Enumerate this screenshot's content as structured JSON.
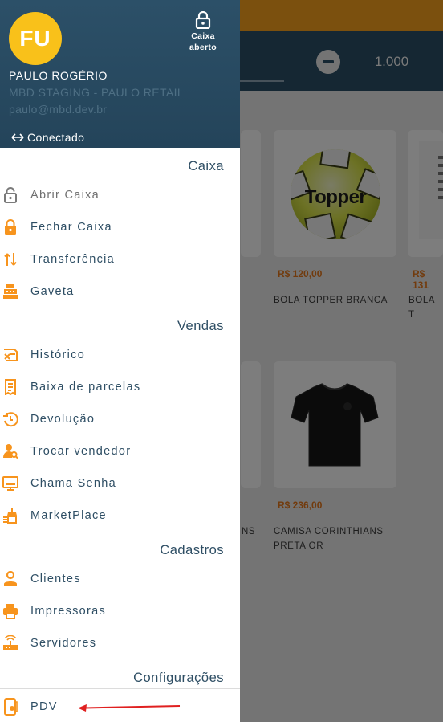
{
  "background": {
    "quantity": "1.000",
    "products": [
      {
        "price": "R$ 120,00",
        "name": "BOLA TOPPER BRANCA"
      },
      {
        "price": "R$ 131",
        "name": "BOLA T"
      },
      {
        "price": "R$ 236,00",
        "name_line1": "CAMISA CORINTHIANS",
        "name_line2": "PRETA OR"
      },
      {
        "fragment": "NS"
      }
    ],
    "ball_logo_text": "Topper"
  },
  "drawer": {
    "avatar_initials": "FU",
    "caixa_status": {
      "line1": "Caixa",
      "line2": "aberto",
      "icon": "lock-open-icon"
    },
    "user": {
      "name": "PAULO ROGÉRIO",
      "store": "MBD STAGING - PAULO RETAIL",
      "email": "paulo@mbd.dev.br"
    },
    "connection": {
      "label": "Conectado",
      "icon": "arrows-horizontal-icon"
    },
    "sections": [
      {
        "title": "Caixa",
        "items": [
          {
            "label": "Abrir Caixa",
            "icon": "lock-open-icon",
            "disabled": true
          },
          {
            "label": "Fechar Caixa",
            "icon": "lock-icon"
          },
          {
            "label": "Transferência",
            "icon": "swap-vertical-icon"
          },
          {
            "label": "Gaveta",
            "icon": "cash-register-icon"
          }
        ]
      },
      {
        "title": "Vendas",
        "items": [
          {
            "label": "Histórico",
            "icon": "history-icon"
          },
          {
            "label": "Baixa de parcelas",
            "icon": "receipt-icon"
          },
          {
            "label": "Devolução",
            "icon": "return-icon"
          },
          {
            "label": "Trocar vendedor",
            "icon": "user-search-icon"
          },
          {
            "label": "Chama Senha",
            "icon": "monitor-icon"
          },
          {
            "label": "MarketPlace",
            "icon": "marketplace-icon"
          }
        ]
      },
      {
        "title": "Cadastros",
        "items": [
          {
            "label": "Clientes",
            "icon": "person-icon"
          },
          {
            "label": "Impressoras",
            "icon": "printer-icon"
          },
          {
            "label": "Servidores",
            "icon": "router-icon"
          }
        ]
      },
      {
        "title": "Configurações",
        "items": [
          {
            "label": "PDV",
            "icon": "pos-device-icon"
          }
        ]
      }
    ]
  },
  "colors": {
    "accent": "#f7941d",
    "header": "#2c5068",
    "text": "#2e4e64",
    "annotation_arrow": "#e02020"
  }
}
